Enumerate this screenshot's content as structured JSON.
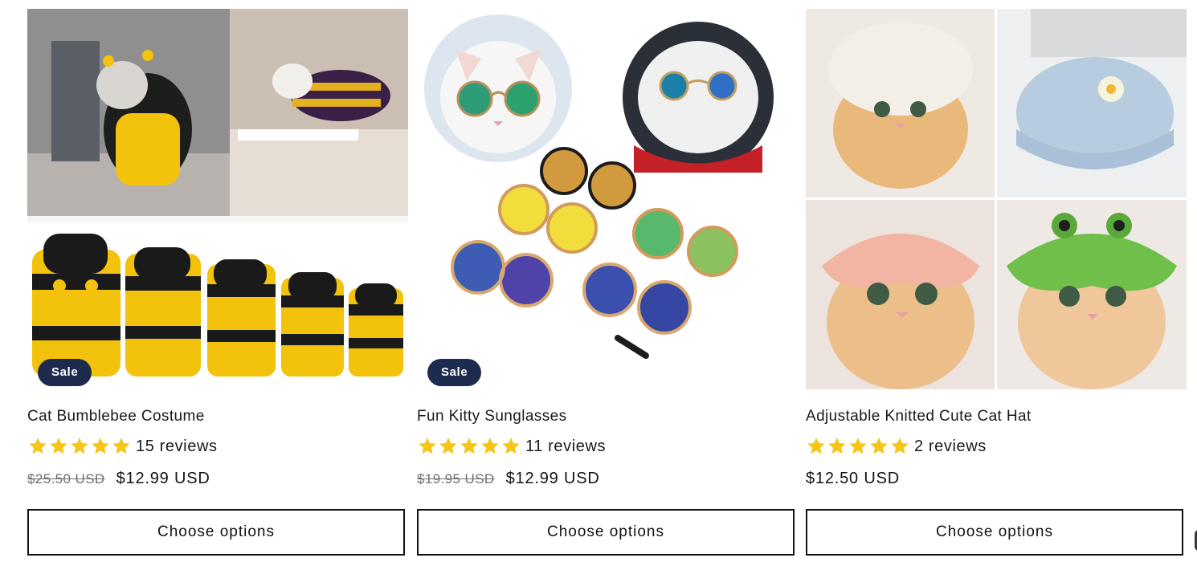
{
  "colors": {
    "badge": "#1d2b4f",
    "star": "#f5c518",
    "button_border": "#121212"
  },
  "products": [
    {
      "image_alt": "Dogs and cats wearing yellow and black striped bee hoodies",
      "badge": "Sale",
      "title": "Cat Bumblebee Costume",
      "rating": 5,
      "reviews": "15 reviews",
      "compare_price": "$25.50 USD",
      "price": "$12.99 USD",
      "button": "Choose options"
    },
    {
      "image_alt": "Cats wearing round sunglasses and assorted colored round sunglasses",
      "badge": "Sale",
      "title": "Fun Kitty Sunglasses",
      "rating": 5,
      "reviews": "11 reviews",
      "compare_price": "$19.95 USD",
      "price": "$12.99 USD",
      "button": "Choose options"
    },
    {
      "image_alt": "Kittens wearing knitted hats in white, blue, pink and green frog style",
      "badge": "",
      "title": "Adjustable Knitted Cute Cat Hat",
      "rating": 5,
      "reviews": "2 reviews",
      "compare_price": "",
      "price": "$12.50 USD",
      "button": "Choose options"
    }
  ]
}
